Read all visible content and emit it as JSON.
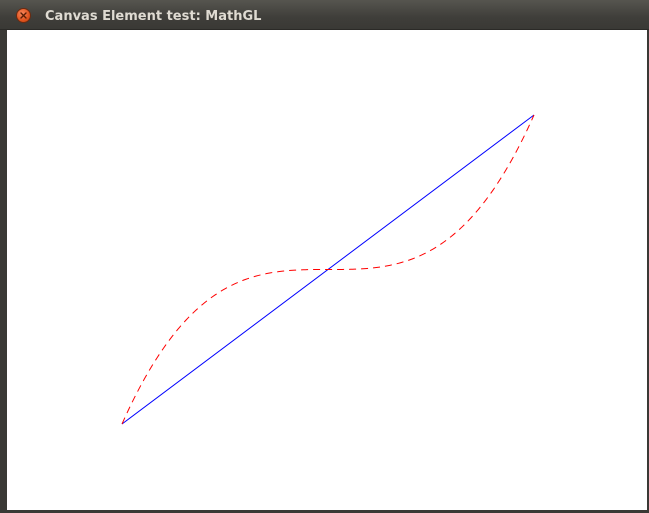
{
  "window": {
    "title": "Canvas Element test: MathGL"
  },
  "chart_data": {
    "type": "line",
    "xlim": [
      -1,
      1
    ],
    "ylim": [
      -1,
      1
    ],
    "grid": false,
    "series": [
      {
        "style": "solid",
        "color": "#0000ff",
        "function": "x",
        "x": [
          -1,
          1
        ],
        "y": [
          -1,
          1
        ]
      },
      {
        "style": "dashed",
        "color": "#ff0000",
        "function": "x^3",
        "x": [
          -1.0,
          -0.9,
          -0.8,
          -0.7,
          -0.6,
          -0.5,
          -0.4,
          -0.3,
          -0.2,
          -0.1,
          0.0,
          0.1,
          0.2,
          0.3,
          0.4,
          0.5,
          0.6,
          0.7,
          0.8,
          0.9,
          1.0
        ],
        "y": [
          -1.0,
          -0.729,
          -0.512,
          -0.343,
          -0.216,
          -0.125,
          -0.064,
          -0.027,
          -0.008,
          -0.001,
          0.0,
          0.001,
          0.008,
          0.027,
          0.064,
          0.125,
          0.216,
          0.343,
          0.512,
          0.729,
          1.0
        ]
      }
    ]
  }
}
